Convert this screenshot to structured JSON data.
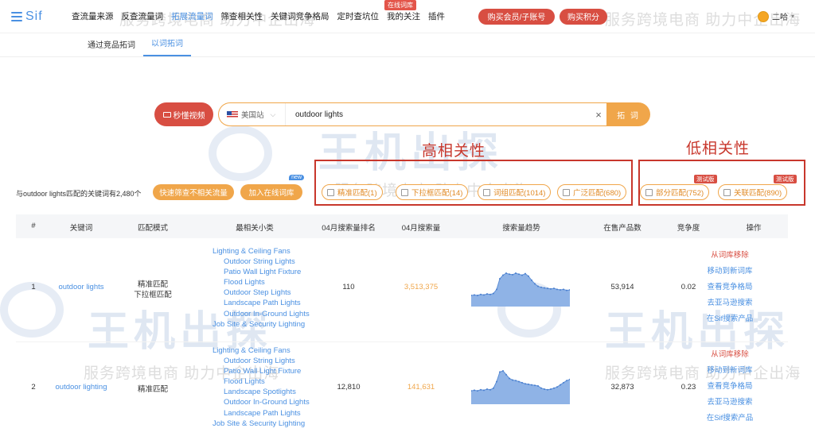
{
  "nav": {
    "logo": "Sif",
    "items": [
      "查流量来源",
      "反查流量词",
      "拓展流量词",
      "筛查相关性",
      "关键词竞争格局",
      "定时查坑位",
      "我的关注",
      "插件"
    ],
    "badge": "在线词库",
    "buy_member": "购买会员/子账号",
    "buy_points": "购买积分",
    "user": "二哈"
  },
  "tabs": [
    "通过竞品拓词",
    "以词拓词"
  ],
  "search": {
    "video_button": "秒懂视频",
    "site": "美国站",
    "query": "outdoor lights",
    "clear": "×",
    "button": "拓 词"
  },
  "annotations": {
    "high": "高相关性",
    "low": "低相关性"
  },
  "filters": {
    "count_text": "与outdoor lights匹配的关键词有2,480个",
    "quick_filter": "快速筛查不相关流量",
    "add_to_lib": "加入在线词库",
    "new_badge": "new",
    "chips": [
      "精准匹配(1)",
      "下拉框匹配(14)",
      "词组匹配(1014)",
      "广泛匹配(680)",
      "部分匹配(752)",
      "关联匹配(890)"
    ],
    "test_badge": "测试版"
  },
  "table": {
    "headers": [
      "#",
      "关键词",
      "匹配模式",
      "最相关小类",
      "04月搜索量排名",
      "04月搜索量",
      "搜索量趋势",
      "在售产品数",
      "竞争度",
      "操作"
    ],
    "rows": [
      {
        "index": "1",
        "keyword": "outdoor lights",
        "match": [
          "精准匹配",
          "下拉框匹配"
        ],
        "categories": [
          "Lighting & Ceiling Fans",
          "Outdoor String Lights",
          "Patio Wall Light Fixture",
          "Flood Lights",
          "Outdoor Step Lights",
          "Landscape Path Lights",
          "Outdoor In-Ground Lights",
          "Job Site & Security Lighting"
        ],
        "rank": "110",
        "volume": "3,513,375",
        "trend": [
          22,
          23,
          22,
          24,
          23,
          25,
          24,
          26,
          34,
          55,
          62,
          66,
          64,
          63,
          66,
          64,
          62,
          65,
          60,
          52,
          45,
          40,
          38,
          37,
          36,
          35,
          36,
          34,
          33,
          34,
          32,
          33
        ],
        "products": "53,914",
        "competition": "0.02",
        "ops": [
          "从词库移除",
          "移动到新词库",
          "查看竞争格局",
          "去亚马逊搜索",
          "在Sif搜索产品"
        ]
      },
      {
        "index": "2",
        "keyword": "outdoor lighting",
        "match": [
          "精准匹配"
        ],
        "categories": [
          "Lighting & Ceiling Fans",
          "Outdoor String Lights",
          "Patio Wall Light Fixture",
          "Flood Lights",
          "Landscape Spotlights",
          "Outdoor In-Ground Lights",
          "Landscape Path Lights",
          "Job Site & Security Lighting"
        ],
        "rank": "12,810",
        "volume": "141,631",
        "trend": [
          25,
          26,
          25,
          27,
          26,
          28,
          27,
          30,
          42,
          60,
          62,
          55,
          48,
          45,
          44,
          42,
          40,
          38,
          37,
          36,
          35,
          34,
          30,
          28,
          27,
          28,
          30,
          32,
          36,
          40,
          44,
          46
        ],
        "products": "32,873",
        "competition": "0.23",
        "ops": [
          "从词库移除",
          "移动到新词库",
          "查看竞争格局",
          "去亚马逊搜索",
          "在Sif搜索产品"
        ]
      }
    ]
  },
  "watermark": {
    "big": "王机出探",
    "small": "服务跨境电商  助力中企出海"
  },
  "colors": {
    "accent": "#4a90e2",
    "orange": "#f0a64a",
    "red": "#d84e42",
    "annotation": "#c8372c"
  }
}
